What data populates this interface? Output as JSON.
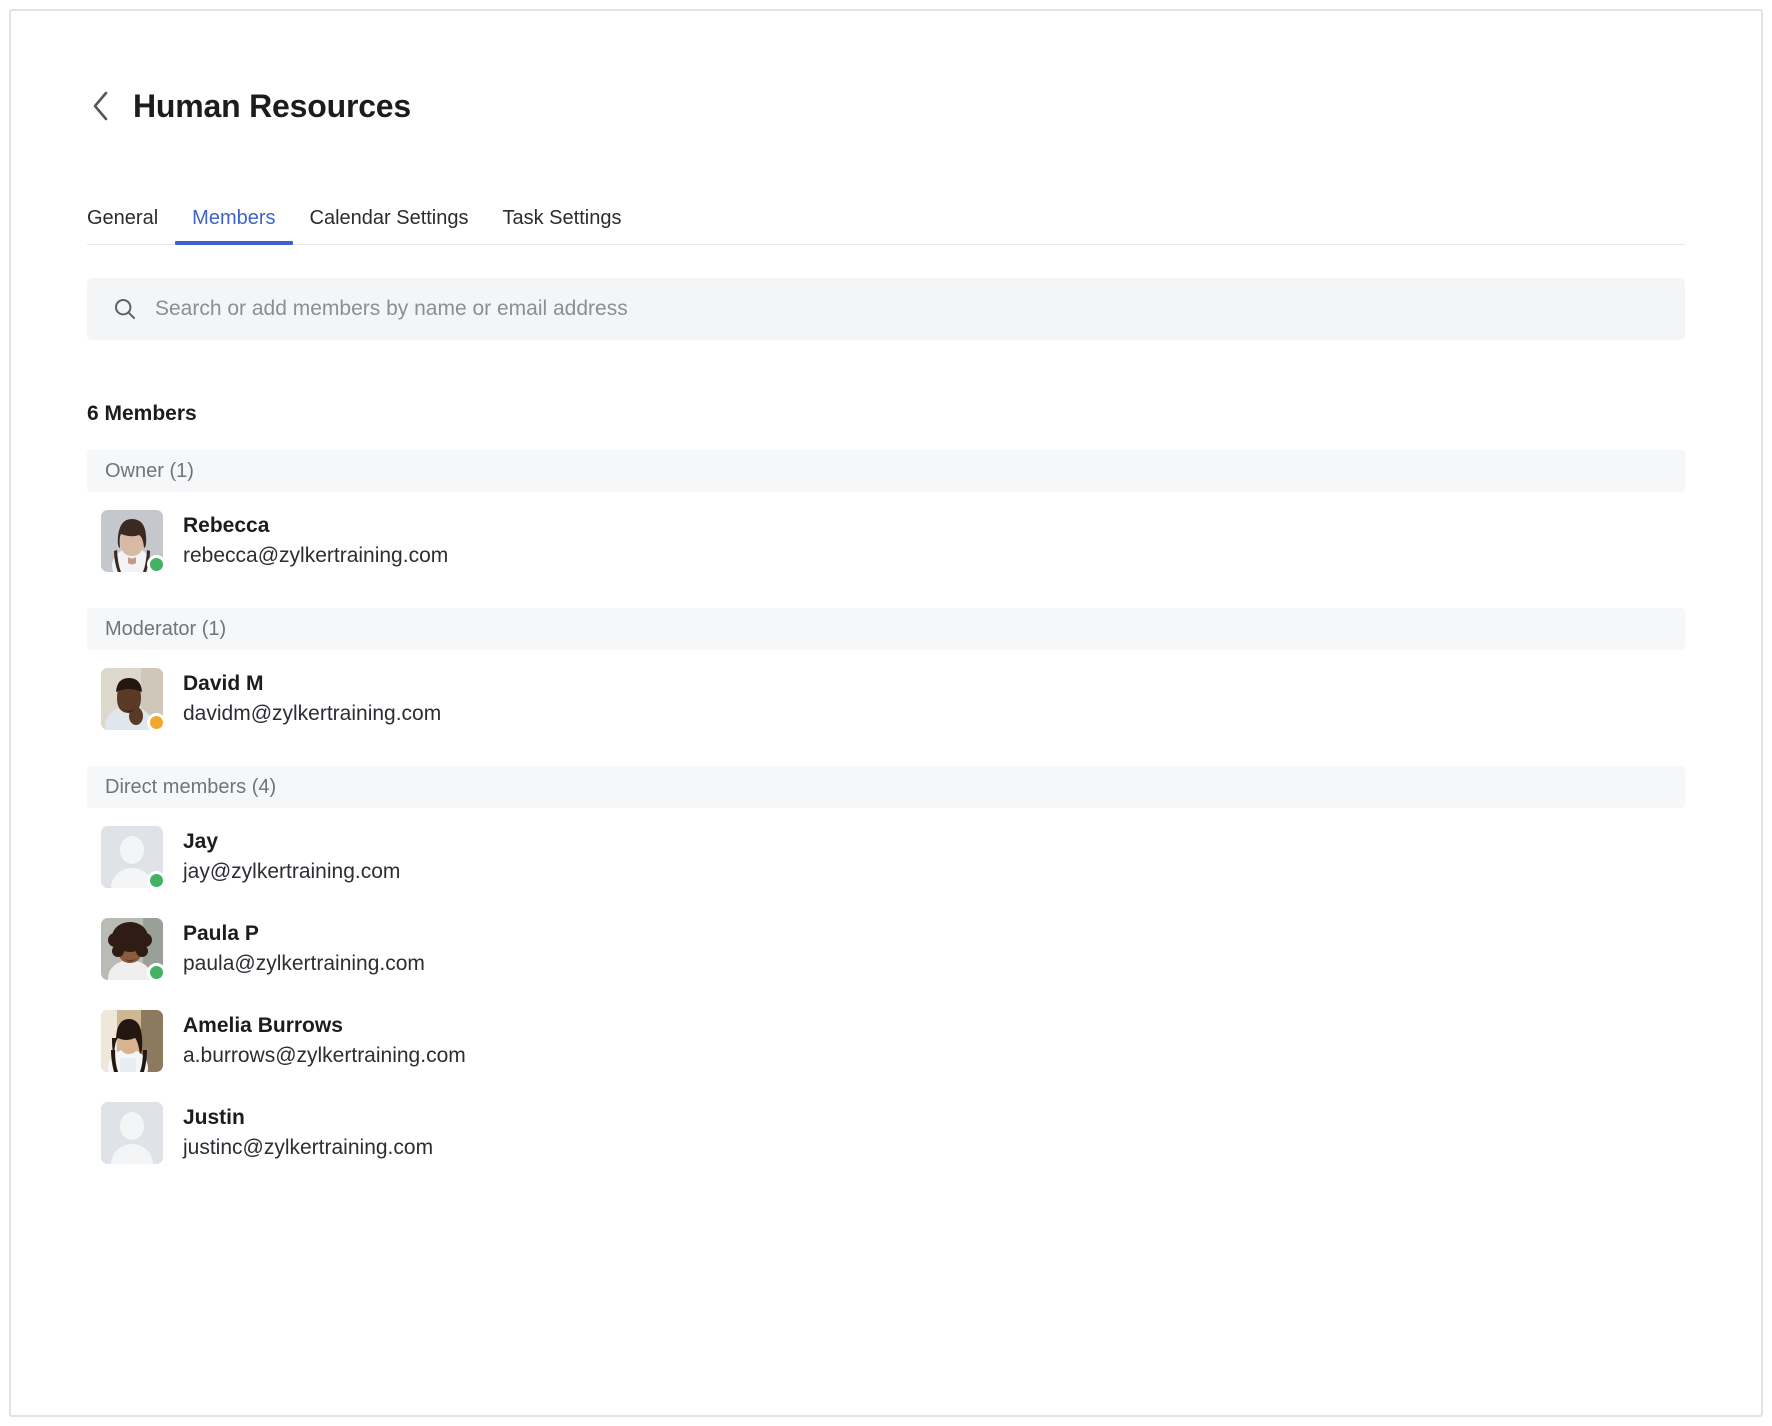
{
  "header": {
    "back_icon": "chevron-left-icon",
    "title": "Human Resources"
  },
  "tabs": [
    {
      "label": "General",
      "active": false
    },
    {
      "label": "Members",
      "active": true
    },
    {
      "label": "Calendar Settings",
      "active": false
    },
    {
      "label": "Task Settings",
      "active": false
    }
  ],
  "search": {
    "icon": "search-icon",
    "placeholder": "Search or add members by name or email address",
    "value": ""
  },
  "member_count_label": "6 Members",
  "colors": {
    "accent": "#3d64c9",
    "status_online": "#44b163",
    "status_away": "#f0a930",
    "group_header_bg": "#f6f7f8",
    "search_bg": "#f4f5f6",
    "frame_border": "#dde3e8"
  },
  "groups": [
    {
      "header": "Owner (1)",
      "members": [
        {
          "name": "Rebecca",
          "email": "rebecca@zylkertraining.com",
          "status": "online",
          "avatar_type": "photo",
          "avatar_name": "avatar-rebecca"
        }
      ]
    },
    {
      "header": "Moderator (1)",
      "members": [
        {
          "name": "David M",
          "email": "davidm@zylkertraining.com",
          "status": "away",
          "avatar_type": "photo",
          "avatar_name": "avatar-david-m"
        }
      ]
    },
    {
      "header": "Direct members (4)",
      "members": [
        {
          "name": "Jay",
          "email": "jay@zylkertraining.com",
          "status": "online",
          "avatar_type": "placeholder",
          "avatar_name": "avatar-jay"
        },
        {
          "name": "Paula P",
          "email": "paula@zylkertraining.com",
          "status": "online",
          "avatar_type": "photo",
          "avatar_name": "avatar-paula-p"
        },
        {
          "name": "Amelia Burrows",
          "email": "a.burrows@zylkertraining.com",
          "status": "none",
          "avatar_type": "photo",
          "avatar_name": "avatar-amelia-burrows"
        },
        {
          "name": "Justin",
          "email": "justinc@zylkertraining.com",
          "status": "none",
          "avatar_type": "placeholder",
          "avatar_name": "avatar-justin"
        }
      ]
    }
  ]
}
